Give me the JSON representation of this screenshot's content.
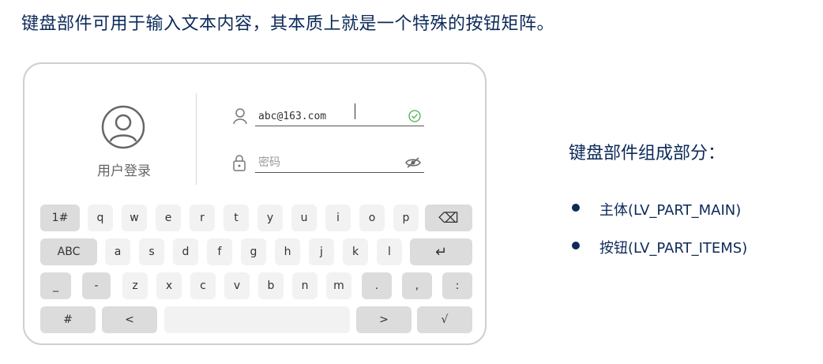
{
  "heading": "键盘部件可用于输入文本内容，其本质上就是一个特殊的按钮矩阵。",
  "login": {
    "label": "用户登录",
    "email_value": "abc@163.com",
    "password_placeholder": "密码"
  },
  "keyboard": {
    "row1": [
      "1#",
      "q",
      "w",
      "e",
      "r",
      "t",
      "y",
      "u",
      "i",
      "o",
      "p",
      "⌫"
    ],
    "row2": [
      "ABC",
      "a",
      "s",
      "d",
      "f",
      "g",
      "h",
      "j",
      "k",
      "l",
      "↵"
    ],
    "row3": [
      "_",
      "-",
      "z",
      "x",
      "c",
      "v",
      "b",
      "n",
      "m",
      ".",
      ",",
      ":"
    ],
    "row4": [
      "#",
      "<",
      "",
      ">",
      "√"
    ]
  },
  "sidebar": {
    "title": "键盘部件组成部分：",
    "items": [
      "主体(LV_PART_MAIN)",
      "按钮(LV_PART_ITEMS)"
    ]
  },
  "colors": {
    "accent": "#0d2a5a",
    "valid_check": "#4caf50",
    "key_bg": "#f2f2f2",
    "key_bg_dark": "#dcdcdc"
  },
  "icons": {
    "avatar": "user-circle-icon",
    "email": "user-icon",
    "password": "lock-icon",
    "valid": "check-circle-icon",
    "visibility": "eye-hidden-icon"
  }
}
